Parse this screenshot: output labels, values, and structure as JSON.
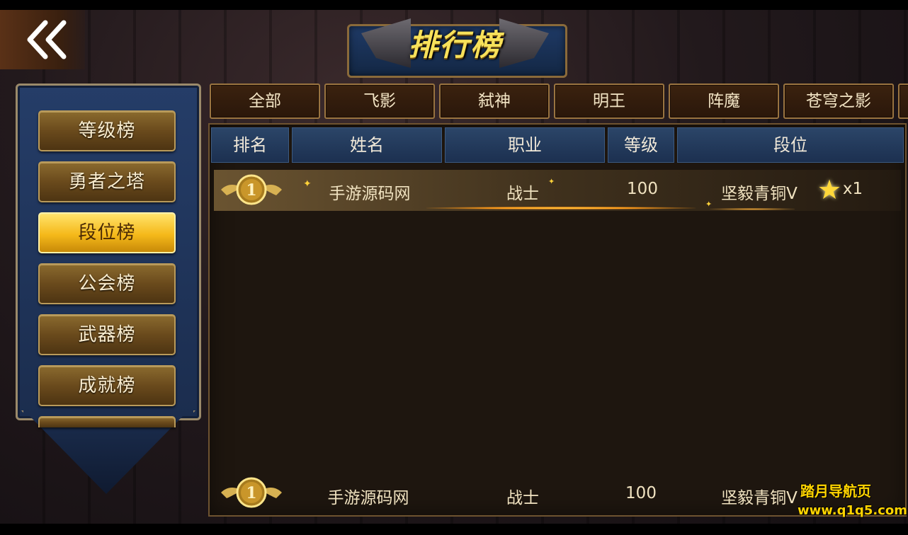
{
  "title": "排行榜",
  "back_icon": "double-chevron-left-icon",
  "categories": [
    "等级榜",
    "勇者之塔",
    "段位榜",
    "公会榜",
    "武器榜",
    "成就榜"
  ],
  "active_category": 2,
  "tabs": [
    "全部",
    "飞影",
    "弑神",
    "明王",
    "阵魔",
    "苍穹之影"
  ],
  "table": {
    "headers": {
      "rank": "排名",
      "name": "姓名",
      "class": "职业",
      "level": "等级",
      "tier": "段位"
    },
    "rows": [
      {
        "rank": "1",
        "name": "手游源码网",
        "class": "战士",
        "level": "100",
        "tier": "坚毅青铜V",
        "stars": "x1"
      }
    ],
    "self_row": {
      "rank": "1",
      "name": "手游源码网",
      "class": "战士",
      "level": "100",
      "tier": "坚毅青铜V"
    }
  },
  "watermark": {
    "line1": "踏月导航页",
    "line2": "www.q1q5.com"
  },
  "colors": {
    "accent": "#f5b91a",
    "header_blue": "#2b4568",
    "panel_blue": "#253d68",
    "text_gold": "#f7e15a"
  }
}
